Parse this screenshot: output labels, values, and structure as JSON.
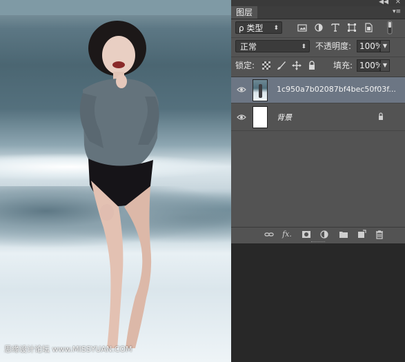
{
  "panel": {
    "tab_label": "图层",
    "collapse_glyph": "◀◀",
    "close_glyph": "×",
    "menu_glyph": "▾≡"
  },
  "filter": {
    "kind_label": "ρ 类型",
    "icons": [
      "image-filter-icon",
      "adjustment-filter-icon",
      "type-filter-icon",
      "shape-filter-icon",
      "smartobject-filter-icon",
      "filter-toggle-icon"
    ]
  },
  "blend": {
    "mode": "正常",
    "opacity_label": "不透明度:",
    "opacity_value": "100%"
  },
  "lock": {
    "label": "锁定:",
    "fill_label": "填充:",
    "fill_value": "100%"
  },
  "layers": [
    {
      "name": "1c950a7b02087bf4bec50f03f...",
      "visible": true,
      "selected": true,
      "thumb": "photo",
      "locked": false
    },
    {
      "name": "背景",
      "visible": true,
      "selected": false,
      "thumb": "white",
      "locked": true
    }
  ],
  "bottom_icons": [
    "link-layers-icon",
    "fx-icon",
    "layer-mask-icon",
    "adjustment-layer-icon",
    "group-folder-icon",
    "new-layer-icon",
    "delete-layer-icon"
  ],
  "watermark": "思缘设计论坛 www.MISSYUAN.COM",
  "colors": {
    "panel_bg": "#535353",
    "selected_layer": "#6c7684",
    "dark_area": "#282828"
  }
}
